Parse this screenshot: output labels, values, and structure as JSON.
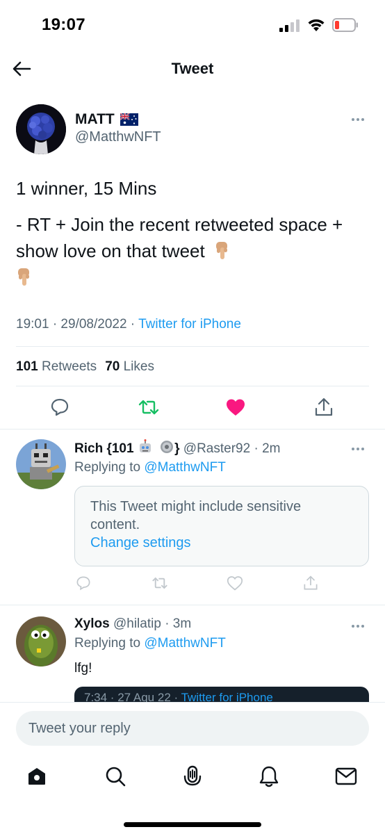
{
  "status_bar": {
    "time": "19:07"
  },
  "header": {
    "title": "Tweet"
  },
  "main_tweet": {
    "author_name": "MATT",
    "author_handle": "@MatthwNFT",
    "text_line1": "1 winner, 15 Mins",
    "text_line2": "- RT + Join the recent retweeted space + show love on that tweet",
    "timestamp": "19:01 · 29/08/2022 · ",
    "source": "Twitter for iPhone",
    "retweets_count": "101",
    "retweets_label": "Retweets",
    "likes_count": "70",
    "likes_label": "Likes",
    "liked": true,
    "retweet_color": "#17bf63",
    "like_color": "#f91880"
  },
  "replies": [
    {
      "name": "Rich {101",
      "name_suffix": "}",
      "handle": "@Raster92",
      "time": "· 2m",
      "replying_prefix": "Replying to ",
      "replying_to": "@MatthwNFT",
      "sensitive_text": "This Tweet might include sensitive content.",
      "sensitive_link": "Change settings"
    },
    {
      "name": "Xylos",
      "handle": "@hilatip",
      "time": "· 3m",
      "replying_prefix": "Replying to ",
      "replying_to": "@MatthwNFT",
      "body": "lfg!",
      "quote_time": "7:34 · 27 Agu 22 · ",
      "quote_source": "Twitter for iPhone"
    }
  ],
  "compose": {
    "placeholder": "Tweet your reply"
  },
  "tabbar": {
    "items": [
      "home-icon",
      "search-icon",
      "spaces-icon",
      "notifications-icon",
      "messages-icon"
    ]
  },
  "colors": {
    "accent": "#1d9bf0",
    "secondary_text": "#536471",
    "divider": "#e6ecf0"
  }
}
